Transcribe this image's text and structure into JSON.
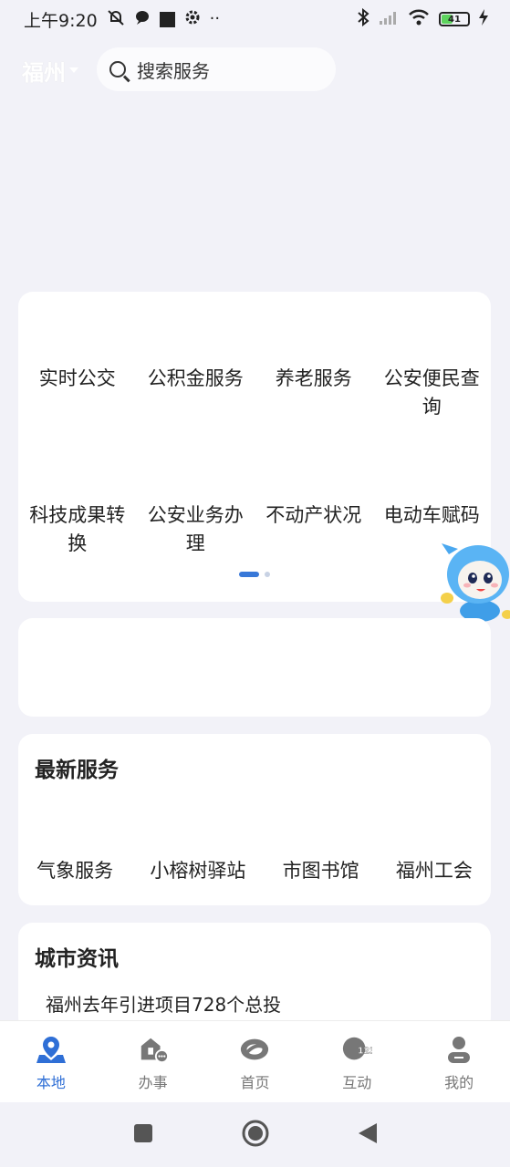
{
  "status_bar": {
    "time": "上午9:20",
    "battery_level": "41"
  },
  "top_bar": {
    "city": "福州",
    "search_placeholder": "搜索服务"
  },
  "services": {
    "items": [
      "实时公交",
      "公积金服务",
      "养老服务",
      "公安便民查询",
      "科技成果转换",
      "公安业务办理",
      "不动产状况",
      "电动车赋码"
    ],
    "page_count": 2,
    "current_page": 1
  },
  "latest_services": {
    "title": "最新服务",
    "items": [
      "气象服务",
      "小榕树驿站",
      "市图书馆",
      "福州工会"
    ]
  },
  "city_news": {
    "title": "城市资讯",
    "headline": "福州去年引进项目728个总投"
  },
  "bottom_nav": {
    "items": [
      {
        "label": "本地",
        "icon": "location-icon",
        "active": true
      },
      {
        "label": "办事",
        "icon": "service-hall-icon",
        "active": false
      },
      {
        "label": "首页",
        "icon": "home-logo-icon",
        "active": false
      },
      {
        "label": "互动",
        "icon": "hotline-12345-icon",
        "active": false
      },
      {
        "label": "我的",
        "icon": "user-icon",
        "active": false
      }
    ],
    "hotline_text": "12345"
  },
  "colors": {
    "accent": "#2f6fd6",
    "background": "#f2f2f8",
    "inactive": "#777777"
  }
}
